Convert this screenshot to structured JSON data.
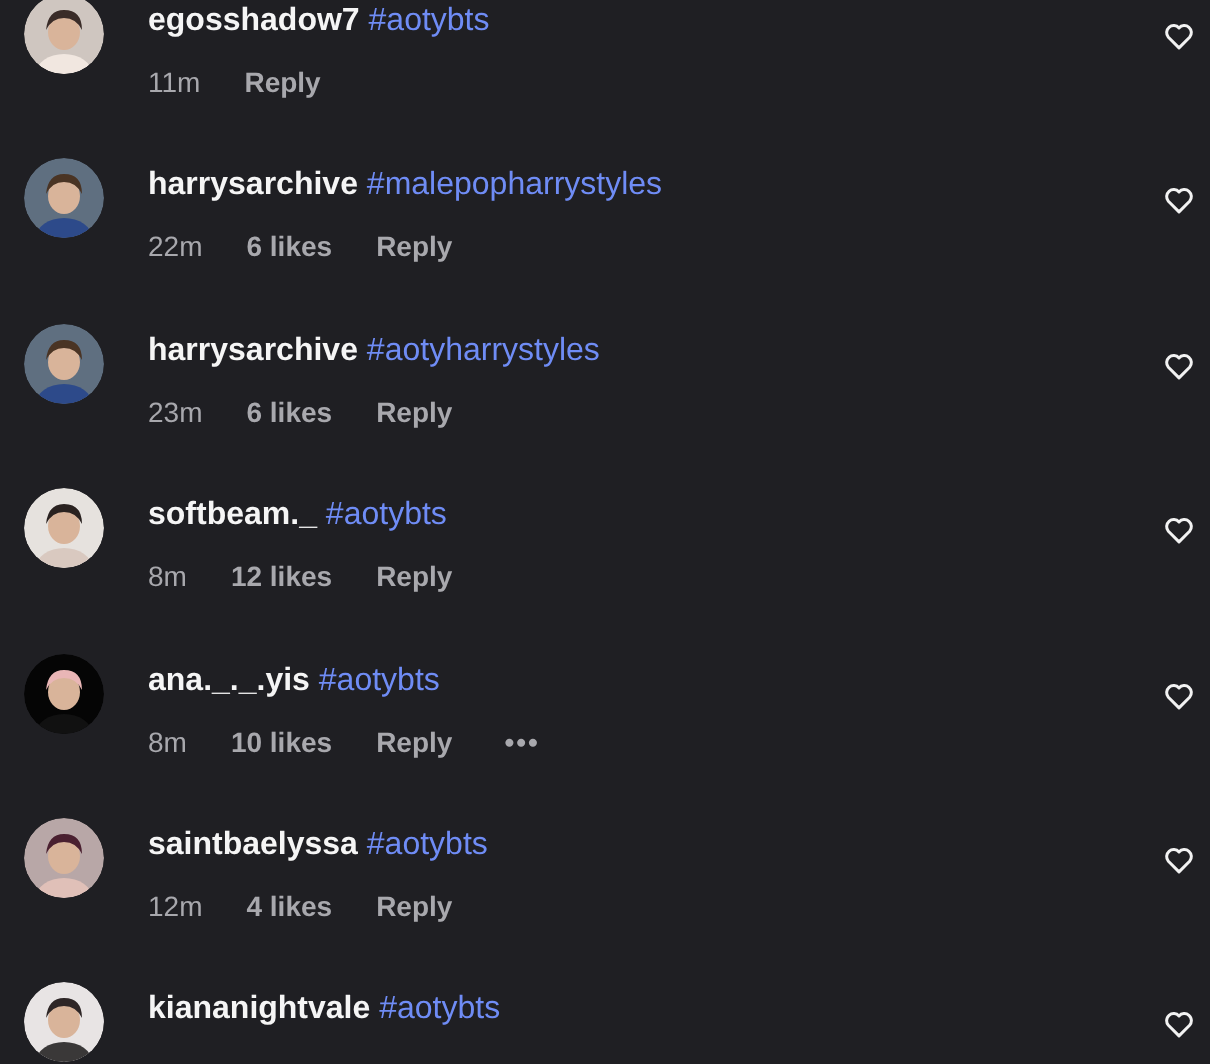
{
  "comments": [
    {
      "user": "egosshadow7",
      "hashtag": "#aotybts",
      "time": "11m",
      "reply": "Reply"
    },
    {
      "user": "harrysarchive",
      "hashtag": "#malepopharrystyles",
      "time": "22m",
      "likes": "6 likes",
      "reply": "Reply"
    },
    {
      "user": "harrysarchive",
      "hashtag": "#aotyharrystyles",
      "time": "23m",
      "likes": "6 likes",
      "reply": "Reply"
    },
    {
      "user": "softbeam._",
      "hashtag": "#aotybts",
      "time": "8m",
      "likes": "12 likes",
      "reply": "Reply"
    },
    {
      "user": "ana._._.yis",
      "hashtag": "#aotybts",
      "time": "8m",
      "likes": "10 likes",
      "reply": "Reply",
      "more": "•••"
    },
    {
      "user": "saintbaelyssa",
      "hashtag": "#aotybts",
      "time": "12m",
      "likes": "4 likes",
      "reply": "Reply"
    },
    {
      "user": "kiananightvale",
      "hashtag": "#aotybts"
    }
  ]
}
